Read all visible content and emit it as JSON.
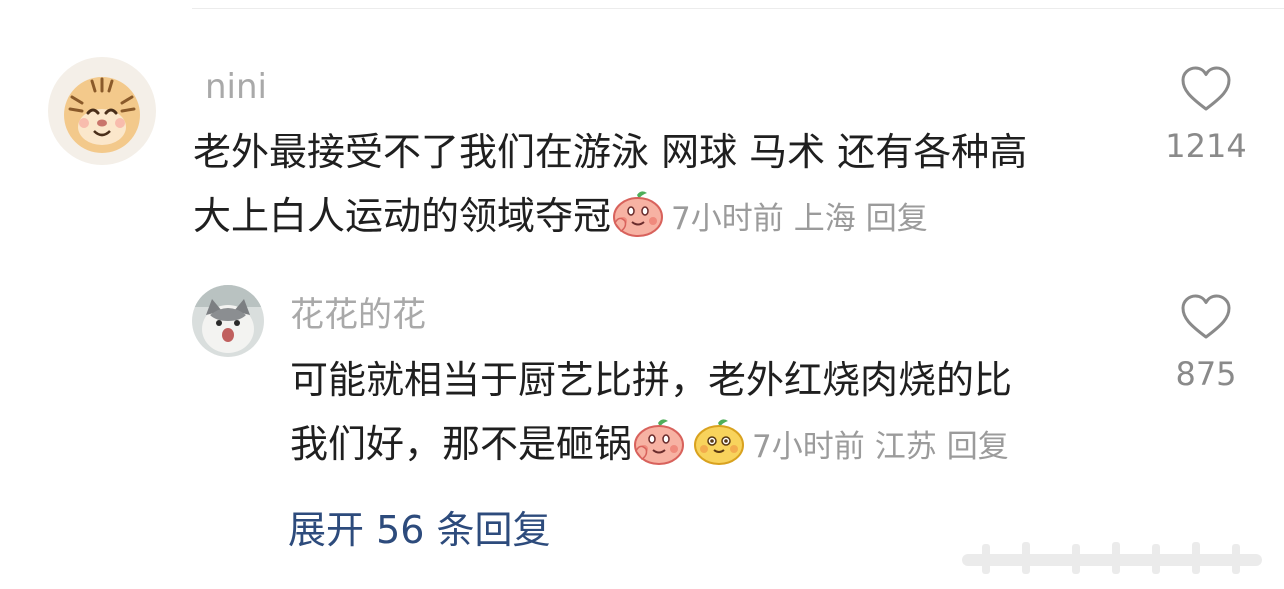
{
  "comments": [
    {
      "username": "nini",
      "text_line1": "老外最接受不了我们在游泳 网球 马术 还有各种高",
      "text_line2": "大上白人运动的领域夺冠",
      "time": "7小时前",
      "location": "上海",
      "reply_label": "回复",
      "likes": "1214",
      "emojis": [
        "shy-peach-emoji"
      ]
    },
    {
      "username": "花花的花",
      "text_line1": "可能就相当于厨艺比拼，老外红烧肉烧的比",
      "text_line2": "我们好，那不是砸锅",
      "time": "7小时前",
      "location": "江苏",
      "reply_label": "回复",
      "likes": "875",
      "emojis": [
        "shy-peach-emoji",
        "yellow-bun-emoji"
      ]
    }
  ],
  "expand_replies": "展开 56 条回复",
  "colors": {
    "text": "#1f1f1f",
    "username": "#a9a9a9",
    "meta": "#9b9b9b",
    "link": "#2d4b7c",
    "like_icon": "#8a8a8a"
  }
}
